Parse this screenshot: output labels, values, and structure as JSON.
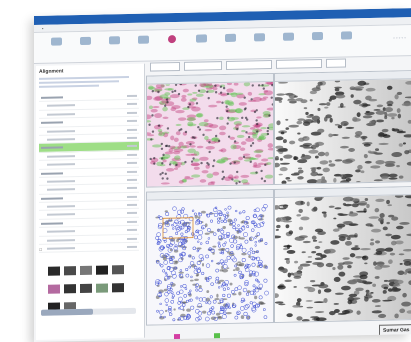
{
  "window": {
    "title": ""
  },
  "ribbon": {
    "items": [
      {
        "label": "",
        "icon": "rect-icon"
      },
      {
        "label": "",
        "icon": "rect-icon"
      },
      {
        "label": "",
        "icon": "rect-icon"
      },
      {
        "label": "",
        "icon": "rect-icon"
      },
      {
        "label": "",
        "icon": "circle-icon",
        "selected": true
      },
      {
        "label": "",
        "icon": "rect-icon"
      },
      {
        "label": "",
        "icon": "rect-icon"
      },
      {
        "label": "",
        "icon": "rect-icon"
      },
      {
        "label": "",
        "icon": "rect-icon"
      },
      {
        "label": "",
        "icon": "rect-icon"
      },
      {
        "label": "",
        "icon": "rect-icon"
      }
    ]
  },
  "left": {
    "title": "Alignment",
    "tree": [
      {
        "type": "grp",
        "sel": false
      },
      {
        "type": "item",
        "sel": false
      },
      {
        "type": "item",
        "sel": false
      },
      {
        "type": "grp",
        "sel": false
      },
      {
        "type": "item",
        "sel": false
      },
      {
        "type": "item",
        "sel": false
      },
      {
        "type": "grp",
        "sel": true
      },
      {
        "type": "item",
        "sel": false
      },
      {
        "type": "item",
        "sel": false
      },
      {
        "type": "grp",
        "sel": false
      },
      {
        "type": "item",
        "sel": false
      },
      {
        "type": "item",
        "sel": false
      },
      {
        "type": "grp",
        "sel": false
      },
      {
        "type": "item",
        "sel": false
      },
      {
        "type": "item",
        "sel": false
      },
      {
        "type": "grp",
        "sel": false
      },
      {
        "type": "item",
        "sel": false
      },
      {
        "type": "item",
        "sel": false
      },
      {
        "type": "item",
        "sel": false
      }
    ],
    "slider_fraction": 0.55
  },
  "toolbar2": {
    "buttons": [
      "",
      "",
      "",
      "",
      ""
    ]
  },
  "panels": {
    "tl": {
      "title": ""
    },
    "tr": {
      "title": ""
    },
    "bl": {
      "title": ""
    },
    "br": {
      "title": ""
    }
  },
  "legend": {
    "a_color": "#d43fa3",
    "b_color": "#58c04a"
  },
  "go_button": "Sumar Gas",
  "colors": {
    "accent": "#1f5fb3",
    "magenta": "#c0407e",
    "green": "#58c04a",
    "spots_blue": "#4b5bd6",
    "highlight": "#9ede86"
  }
}
